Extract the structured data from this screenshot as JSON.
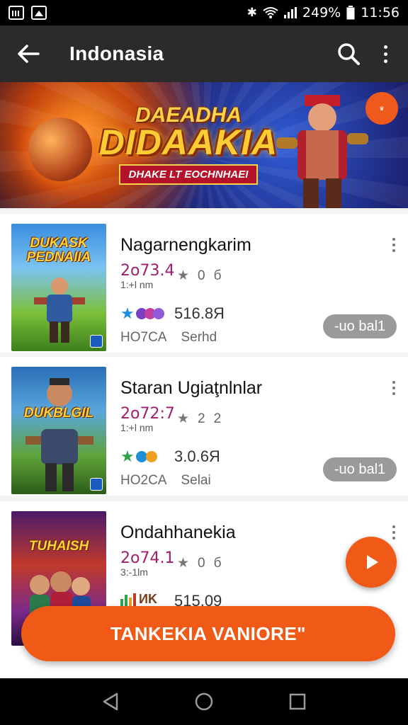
{
  "status_bar": {
    "battery": "249%",
    "time": "11:56",
    "icons": [
      "image-icon",
      "chart-icon",
      "bluetooth-icon",
      "wifi-icon",
      "signal-icon",
      "battery-icon"
    ]
  },
  "app_bar": {
    "title": "Indonasia",
    "icons": [
      "back-arrow-icon",
      "search-icon",
      "more-vert-icon"
    ]
  },
  "banner": {
    "title_small": "DAEADHA",
    "title_big": "DIDAAKIA",
    "tagline": "DHAKE LT EOCHNHAEI"
  },
  "games": [
    {
      "name": "Nagarnengkarim",
      "date": "2o73.4",
      "time": "1:+l nm",
      "rating": "0",
      "rating_extra": "б",
      "size": "516.8Я",
      "meta_left": "HO7CA",
      "meta_right": "Serhd",
      "button": "-uo bal1",
      "thumb_title": "DUKASK PEDNAIIA"
    },
    {
      "name": "Staran Ugiaţnlnlar",
      "date": "2o72:7",
      "time": "1:+l nm",
      "rating": "2",
      "rating_extra": "2",
      "size": "3.0.6Я",
      "meta_left": "HO2CA",
      "meta_right": "Selai",
      "button": "-uo bal1",
      "thumb_title": "DUKBLGIL"
    },
    {
      "name": "Ondahhanekia",
      "date": "2o74.1",
      "time": "3:-1lm",
      "rating": "0",
      "rating_extra": "б",
      "size": "515.09",
      "meta_left": "",
      "meta_right": "",
      "button": "",
      "thumb_title": "TUHAISH"
    }
  ],
  "bottom_action": "TANKEKIA VANIORE\"",
  "colors": {
    "accent": "#f15a16",
    "app_bar": "#2b2b2b",
    "date_text": "#a0206e",
    "pill_button": "#9a9a9a"
  }
}
